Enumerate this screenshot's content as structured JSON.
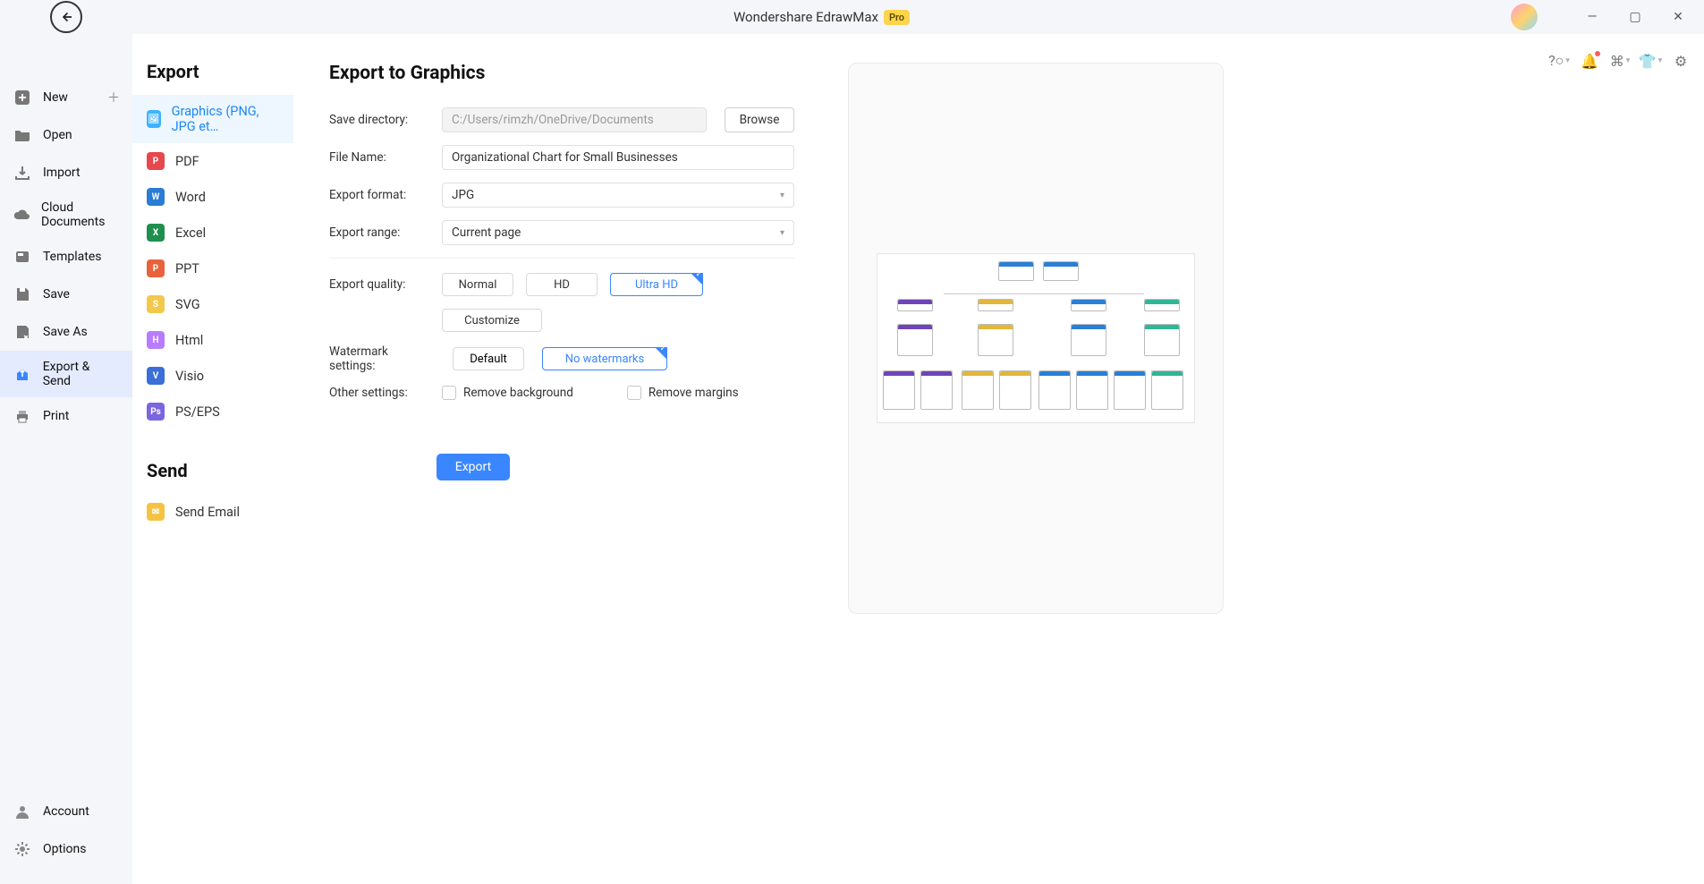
{
  "app": {
    "title": "Wondershare EdrawMax",
    "pro_badge": "Pro"
  },
  "left_nav": {
    "items": [
      {
        "id": "new",
        "label": "New",
        "has_plus": true
      },
      {
        "id": "open",
        "label": "Open"
      },
      {
        "id": "import",
        "label": "Import"
      },
      {
        "id": "cloud",
        "label": "Cloud Documents"
      },
      {
        "id": "templates",
        "label": "Templates"
      },
      {
        "id": "save",
        "label": "Save"
      },
      {
        "id": "saveas",
        "label": "Save As"
      },
      {
        "id": "export",
        "label": "Export & Send",
        "active": true
      },
      {
        "id": "print",
        "label": "Print"
      }
    ],
    "bottom": [
      {
        "id": "account",
        "label": "Account"
      },
      {
        "id": "options",
        "label": "Options"
      }
    ]
  },
  "export_nav": {
    "heading_export": "Export",
    "heading_send": "Send",
    "items": [
      {
        "id": "graphics",
        "label": "Graphics (PNG, JPG et…",
        "color": "#3db2ff",
        "selected": true
      },
      {
        "id": "pdf",
        "label": "PDF",
        "color": "#e5484d"
      },
      {
        "id": "word",
        "label": "Word",
        "color": "#2b7cd3"
      },
      {
        "id": "excel",
        "label": "Excel",
        "color": "#1f8f4e"
      },
      {
        "id": "ppt",
        "label": "PPT",
        "color": "#e8623c"
      },
      {
        "id": "svg",
        "label": "SVG",
        "color": "#f2c94c"
      },
      {
        "id": "html",
        "label": "Html",
        "color": "#b97cff"
      },
      {
        "id": "visio",
        "label": "Visio",
        "color": "#3a6fd8"
      },
      {
        "id": "pseps",
        "label": "PS/EPS",
        "color": "#7c65e0"
      }
    ],
    "send_items": [
      {
        "id": "email",
        "label": "Send Email",
        "color": "#f5c341"
      }
    ]
  },
  "form": {
    "title": "Export to Graphics",
    "labels": {
      "save_dir": "Save directory:",
      "file_name": "File Name:",
      "export_format": "Export format:",
      "export_range": "Export range:",
      "export_quality": "Export quality:",
      "watermark": "Watermark settings:",
      "other": "Other settings:"
    },
    "values": {
      "save_dir": "C:/Users/rimzh/OneDrive/Documents",
      "file_name": "Organizational Chart for Small Businesses",
      "export_format": "JPG",
      "export_range": "Current page"
    },
    "buttons": {
      "browse": "Browse",
      "normal": "Normal",
      "hd": "HD",
      "ultra": "Ultra HD",
      "customize": "Customize",
      "default": "Default",
      "no_watermark": "No watermarks",
      "export": "Export"
    },
    "checks": {
      "remove_bg": "Remove background",
      "remove_margins": "Remove margins"
    }
  }
}
